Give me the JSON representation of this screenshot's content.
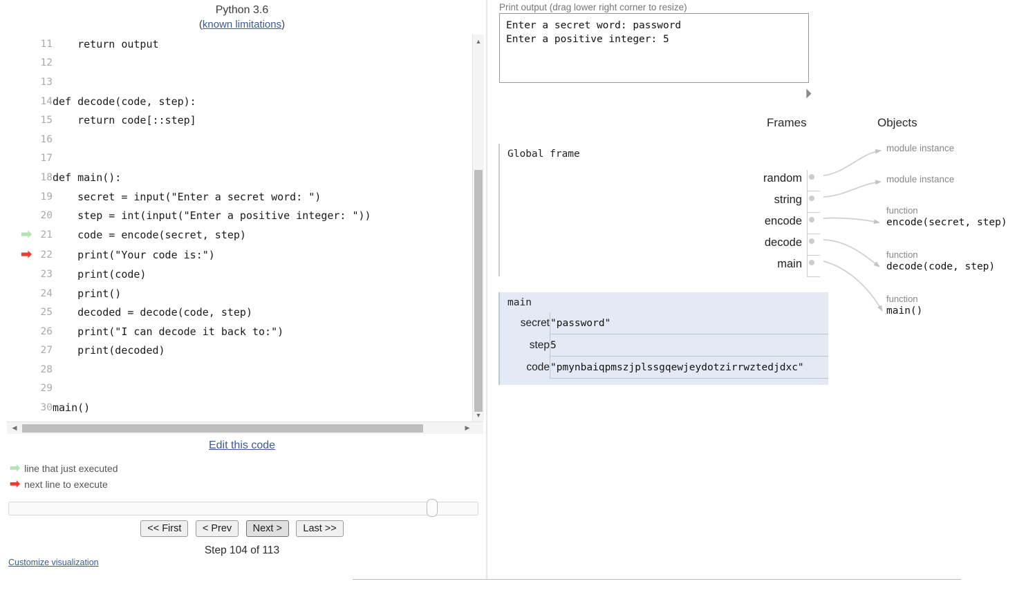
{
  "left": {
    "python_version": "Python 3.6",
    "limitations_prefix": "(",
    "limitations_link": "known limitations",
    "limitations_suffix": ")",
    "code_lines": [
      {
        "num": "11",
        "text": "    return output",
        "arrow": ""
      },
      {
        "num": "12",
        "text": "",
        "arrow": ""
      },
      {
        "num": "13",
        "text": "",
        "arrow": ""
      },
      {
        "num": "14",
        "text": "def decode(code, step):",
        "arrow": ""
      },
      {
        "num": "15",
        "text": "    return code[::step]",
        "arrow": ""
      },
      {
        "num": "16",
        "text": "",
        "arrow": ""
      },
      {
        "num": "17",
        "text": "",
        "arrow": ""
      },
      {
        "num": "18",
        "text": "def main():",
        "arrow": ""
      },
      {
        "num": "19",
        "text": "    secret = input(\"Enter a secret word: \")",
        "arrow": ""
      },
      {
        "num": "20",
        "text": "    step = int(input(\"Enter a positive integer: \"))",
        "arrow": ""
      },
      {
        "num": "21",
        "text": "    code = encode(secret, step)",
        "arrow": "green"
      },
      {
        "num": "22",
        "text": "    print(\"Your code is:\")",
        "arrow": "red"
      },
      {
        "num": "23",
        "text": "    print(code)",
        "arrow": ""
      },
      {
        "num": "24",
        "text": "    print()",
        "arrow": ""
      },
      {
        "num": "25",
        "text": "    decoded = decode(code, step)",
        "arrow": ""
      },
      {
        "num": "26",
        "text": "    print(\"I can decode it back to:\")",
        "arrow": ""
      },
      {
        "num": "27",
        "text": "    print(decoded)",
        "arrow": ""
      },
      {
        "num": "28",
        "text": "",
        "arrow": ""
      },
      {
        "num": "29",
        "text": "",
        "arrow": ""
      },
      {
        "num": "30",
        "text": "main()",
        "arrow": ""
      }
    ],
    "edit_code_label": "Edit this code",
    "legend": {
      "executed_arrow": "➡",
      "executed_label": "line that just executed",
      "next_arrow": "➡",
      "next_label": "next line to execute"
    },
    "nav": {
      "first": "<< First",
      "prev": "< Prev",
      "next": "Next >",
      "last": "Last >>"
    },
    "step_counter": "Step 104 of 113",
    "customize_label": "Customize visualization",
    "colors": {
      "executed_arrow": "#b3e5b3",
      "next_arrow": "#e93f33",
      "link": "#3b5998"
    }
  },
  "right": {
    "print_output_label": "Print output (drag lower right corner to resize)",
    "print_output_text": "Enter a secret word: password\nEnter a positive integer: 5",
    "frames_heading": "Frames",
    "objects_heading": "Objects",
    "global_frame": {
      "title": "Global frame",
      "vars": [
        "random",
        "string",
        "encode",
        "decode",
        "main"
      ]
    },
    "main_frame": {
      "title": "main",
      "vars": [
        {
          "name": "secret",
          "value": "\"password\""
        },
        {
          "name": "step",
          "value": "5"
        },
        {
          "name": "code",
          "value": "\"pmynbaiqpmszjplssgqewjeydotzirrwztedjdxc\""
        }
      ]
    },
    "objects": [
      {
        "kind": "",
        "title": "module instance",
        "simple": true
      },
      {
        "kind": "",
        "title": "module instance",
        "simple": true
      },
      {
        "kind": "function",
        "title": "encode(secret, step)",
        "simple": false
      },
      {
        "kind": "function",
        "title": "decode(code, step)",
        "simple": false
      },
      {
        "kind": "function",
        "title": "main()",
        "simple": false
      }
    ]
  }
}
